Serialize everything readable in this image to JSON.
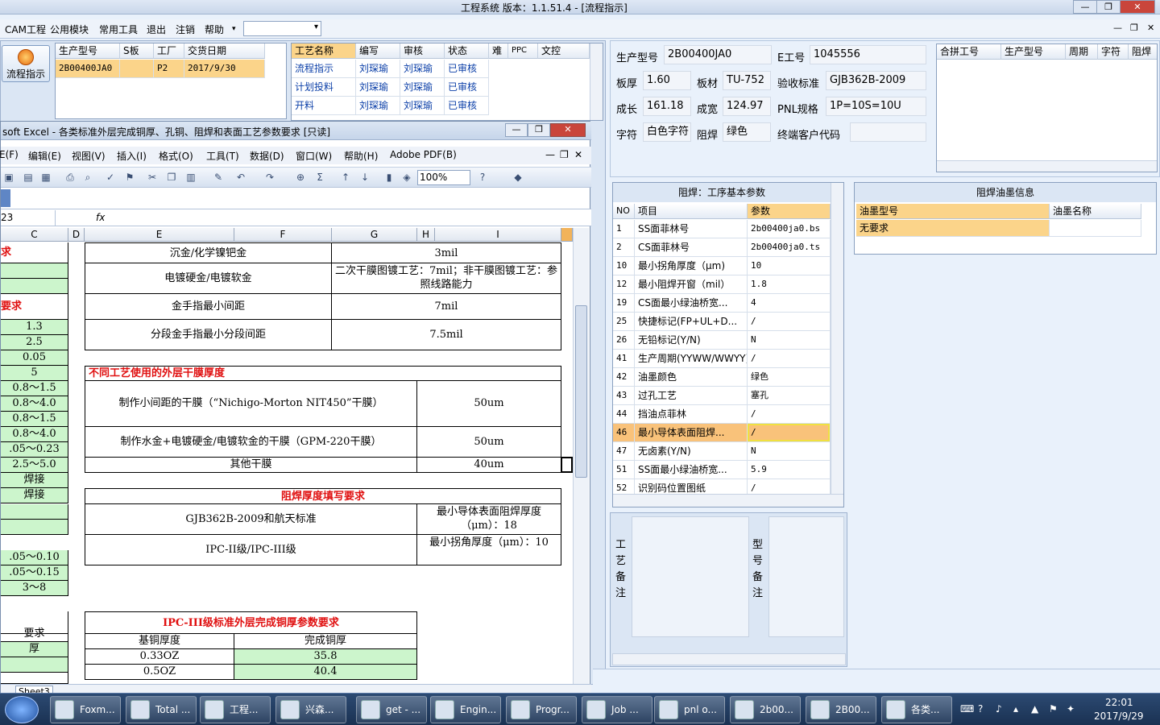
{
  "app": {
    "title": "工程系统    版本：1.1.51.4 - [流程指示]",
    "min": "—",
    "max": "❐",
    "close": "✕"
  },
  "menu": {
    "items": [
      "CAM工程",
      "公用模块",
      "常用工具",
      "退出",
      "注销",
      "帮助"
    ],
    "help_arrow": "▾",
    "mdi": [
      "—",
      "❐",
      "✕"
    ]
  },
  "flow_button": {
    "label": "流程指示"
  },
  "order_grid": {
    "headers": [
      "生产型号",
      "S板",
      "工厂",
      "交货日期"
    ],
    "row": [
      "2B00400JA0",
      "",
      "P2",
      "2017/9/30"
    ]
  },
  "process_grid": {
    "headers": [
      "工艺名称",
      "编写",
      "审核",
      "状态",
      "难",
      "PPC",
      "文控"
    ],
    "rows": [
      [
        "流程指示",
        "刘琛瑜",
        "刘琛瑜",
        "已审核"
      ],
      [
        "计划投料",
        "刘琛瑜",
        "刘琛瑜",
        "已审核"
      ],
      [
        "开料",
        "刘琛瑜",
        "刘琛瑜",
        "已审核"
      ]
    ]
  },
  "info": {
    "prod_model_label": "生产型号",
    "prod_model": "2B00400JA0",
    "e_no_label": "E工号",
    "e_no": "1045556",
    "thick_label": "板厚",
    "thick": "1.60",
    "material_label": "板材",
    "material": "TU-752",
    "std_label": "验收标准",
    "std": "GJB362B-2009",
    "len_label": "成长",
    "len": "161.18",
    "width_label": "成宽",
    "width": "124.97",
    "pnl_label": "PNL规格",
    "pnl": "1P=10S=10U",
    "char_label": "字符",
    "char": "白色字符",
    "mask_label": "阻焊",
    "mask": "绿色",
    "cust_label": "终端客户代码",
    "cust": ""
  },
  "merge_grid": {
    "headers": [
      "合拼工号",
      "生产型号",
      "周期",
      "字符",
      "阻焊"
    ]
  },
  "param_panel": {
    "title": "阻焊：工序基本参数",
    "headers": [
      "NO",
      "项目",
      "参数"
    ],
    "rows": [
      [
        "1",
        "SS面菲林号",
        "2b00400ja0.bs"
      ],
      [
        "2",
        "CS面菲林号",
        "2b00400ja0.ts"
      ],
      [
        "10",
        "最小拐角厚度（μm)",
        "10"
      ],
      [
        "12",
        "最小阻焊开窗（mil）",
        "1.8"
      ],
      [
        "19",
        "CS面最小绿油桥宽...",
        "4"
      ],
      [
        "25",
        "快捷标记(FP+UL+D...",
        "/"
      ],
      [
        "26",
        "无铅标记(Y/N)",
        "N"
      ],
      [
        "41",
        "生产周期(YYWW/WWYY)",
        "/"
      ],
      [
        "42",
        "油墨颜色",
        "绿色"
      ],
      [
        "43",
        "过孔工艺",
        "塞孔"
      ],
      [
        "44",
        "挡油点菲林",
        "/"
      ],
      [
        "46",
        "最小导体表面阻焊...",
        "/"
      ],
      [
        "47",
        "无卤素(Y/N)",
        "N"
      ],
      [
        "51",
        "SS面最小绿油桥宽...",
        "5.9"
      ],
      [
        "52",
        "识别码位置图纸",
        "/"
      ]
    ]
  },
  "ink_panel": {
    "title": "阻焊油墨信息",
    "headers": [
      "油墨型号",
      "油墨名称"
    ],
    "rows": [
      [
        "无要求",
        ""
      ]
    ]
  },
  "notes": {
    "process_label": "工艺备注",
    "model_label": "型号备注"
  },
  "excel": {
    "title": "soft Excel - 各类标准外层完成铜厚、孔铜、阻焊和表面工艺参数要求 [只读]",
    "menus": [
      "E(F)",
      "编辑(E)",
      "视图(V)",
      "插入(I)",
      "格式(O)",
      "工具(T)",
      "数据(D)",
      "窗口(W)",
      "帮助(H)",
      "Adobe PDF(B)"
    ],
    "zoom": "100%",
    "namebox": "23",
    "fx": "fx",
    "cols": [
      "C",
      "D",
      "E",
      "F",
      "G",
      "H",
      "I"
    ],
    "left_col": [
      "求",
      "",
      "",
      "要求",
      "1.3",
      "2.5",
      "0.05",
      "5",
      "0.8～1.5",
      "0.8～4.0",
      "0.8～1.5",
      "0.8～4.0",
      ".05～0.23",
      "2.5～5.0",
      "焊接",
      "焊接",
      "",
      "",
      ".05～0.10",
      ".05～0.15",
      "3～8",
      "",
      "要求",
      "厚",
      "",
      ""
    ],
    "cells": {
      "r1a": "沉金/化学镍钯金",
      "r1b": "3mil",
      "r2a": "电镀硬金/电镀软金",
      "r2b": "二次干膜图镀工艺：7mil；非干膜图镀工艺：参照线路能力",
      "r3a": "金手指最小间距",
      "r3b": "7mil",
      "r4a": "分段金手指最小分段间距",
      "r4b": "7.5mil",
      "sec1": "不同工艺使用的外层干膜厚度",
      "f1a": "制作小间距的干膜（“Nichigo-Morton NIT450”干膜）",
      "f1b": "50um",
      "f2a": "制作水金+电镀硬金/电镀软金的干膜（GPM-220干膜）",
      "f2b": "50um",
      "f3a": "其他干膜",
      "f3b": "40um",
      "sec2": "阻焊厚度填写要求",
      "m1a": "GJB362B-2009和航天标准",
      "m1b": "最小导体表面阻焊厚度（μm）：18",
      "m2a": "IPC-II级/IPC-III级",
      "m2b": "最小拐角厚度（μm）：10",
      "sec3": "IPC-III级标准外层完成铜厚参数要求",
      "h1": "基铜厚度",
      "h2": "完成铜厚",
      "c1a": "0.33OZ",
      "c1b": "35.8",
      "c2a": "0.5OZ",
      "c2b": "40.4"
    },
    "sheet_tab": "Sheet3"
  },
  "taskbar": {
    "items": [
      "Foxm...",
      "Total ...",
      "工程...",
      "兴森...",
      "get - ...",
      "Engin...",
      "Progr...",
      "Job ...",
      "pnl o...",
      "2b00...",
      "2B00...",
      "各类..."
    ],
    "time": "22:01",
    "date": "2017/9/29"
  }
}
